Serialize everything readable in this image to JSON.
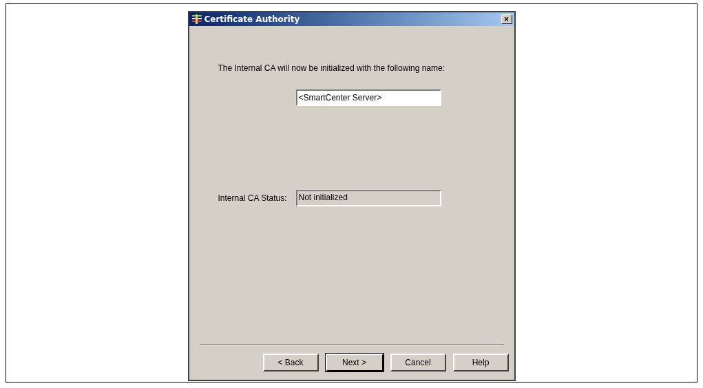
{
  "window": {
    "title": "Certificate Authority",
    "close": "×"
  },
  "intro": "The Internal CA will now be initialized with the following name:",
  "name_field": {
    "value": "<SmartCenter Server>"
  },
  "status": {
    "label": "Internal CA Status:",
    "value": "Not initialized",
    "disabled": true
  },
  "buttons": [
    {
      "label": "< Back",
      "default": false
    },
    {
      "label": "Next >",
      "default": true
    },
    {
      "label": "Cancel",
      "default": false
    },
    {
      "label": "Help",
      "default": false
    }
  ]
}
